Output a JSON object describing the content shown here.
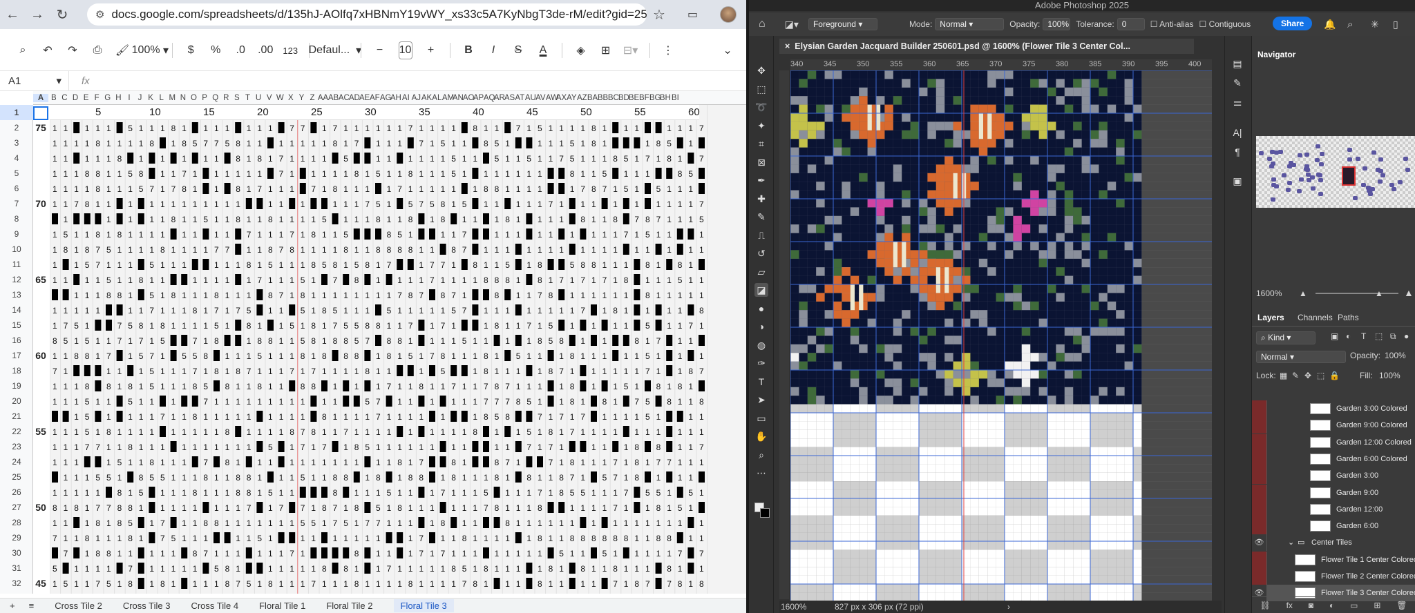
{
  "browser": {
    "url": "docs.google.com/spreadsheets/d/135hJ-AOlfq7xHBNmY19vWY_xs33c5A7KyNbgT3de-rM/edit?gid=25..."
  },
  "sheets": {
    "zoom": "100%",
    "currency": "$",
    "percent": "%",
    "dec_decrease": ".0",
    "dec_increase": ".00",
    "number_format": "123",
    "font": "Defaul...",
    "font_size": "10",
    "bold": "B",
    "italic": "I",
    "strike": "S",
    "textcolor": "A",
    "cell_ref": "A1",
    "fx": "fx",
    "columns": [
      "A",
      "B",
      "C",
      "D",
      "E",
      "F",
      "G",
      "H",
      "I",
      "J",
      "K",
      "L",
      "M",
      "N",
      "O",
      "P",
      "Q",
      "R",
      "S",
      "T",
      "U",
      "V",
      "W",
      "X",
      "Y",
      "Z",
      "AA",
      "AB",
      "AC",
      "AD",
      "AE",
      "AF",
      "AG",
      "AH",
      "AI",
      "AJ",
      "AK",
      "AL",
      "AM",
      "AN",
      "AO",
      "AP",
      "AQ",
      "AR",
      "AS",
      "AT",
      "AU",
      "AV",
      "AW",
      "AX",
      "AY",
      "AZ",
      "BA",
      "BB",
      "BC",
      "BD",
      "BE",
      "BF",
      "BG",
      "BH",
      "BI"
    ],
    "row1_labels": [
      "5",
      "10",
      "15",
      "20",
      "25",
      "30",
      "35",
      "40",
      "45",
      "50",
      "55",
      "60"
    ],
    "row_labels": [
      {
        "row": "2",
        "label": "75"
      },
      {
        "row": "7",
        "label": "70"
      },
      {
        "row": "12",
        "label": "65"
      },
      {
        "row": "17",
        "label": "60"
      },
      {
        "row": "22",
        "label": "55"
      },
      {
        "row": "27",
        "label": "50"
      },
      {
        "row": "32",
        "label": "45"
      }
    ],
    "row_numbers": [
      "1",
      "2",
      "3",
      "4",
      "5",
      "6",
      "7",
      "8",
      "9",
      "10",
      "11",
      "12",
      "13",
      "14",
      "15",
      "16",
      "17",
      "18",
      "19",
      "20",
      "21",
      "22",
      "23",
      "24",
      "25",
      "26",
      "27",
      "28",
      "29",
      "30",
      "31",
      "32"
    ],
    "tabs": [
      "Cross Tile 2",
      "Cross Tile 3",
      "Cross Tile 4",
      "Floral Tile 1",
      "Floral Tile 2",
      "Floral Tile 3"
    ],
    "active_tab": "Floral Tile 3"
  },
  "photoshop": {
    "app_title": "Adobe Photoshop 2025",
    "options": {
      "fill_source": "Foreground",
      "mode_label": "Mode:",
      "mode": "Normal",
      "opacity_label": "Opacity:",
      "opacity": "100%",
      "tolerance_label": "Tolerance:",
      "tolerance": "0",
      "antialias": "Anti-alias",
      "contiguous": "Contiguous",
      "share": "Share"
    },
    "document_tab": "Elysian Garden Jacquard Builder 250601.psd @ 1600% (Flower Tile 3 Center Col...",
    "ruler": [
      "340",
      "345",
      "350",
      "355",
      "360",
      "365",
      "370",
      "375",
      "380",
      "385",
      "390",
      "395",
      "400"
    ],
    "status_zoom": "1600%",
    "status_info": "827 px x 306 px (72 ppi)",
    "navigator": {
      "title": "Navigator",
      "zoom": "1600%"
    },
    "layers_panel": {
      "tabs": [
        "Layers",
        "Channels",
        "Paths"
      ],
      "filter": "Kind",
      "blend": "Normal",
      "opacity_label": "Opacity:",
      "opacity": "100%",
      "lock_label": "Lock:",
      "fill_label": "Fill:",
      "fill": "100%",
      "layers": [
        {
          "name": "Garden 3:00 Colored",
          "visible": false,
          "indent": 1,
          "thumb": true
        },
        {
          "name": "Garden 9:00 Colored",
          "visible": false,
          "indent": 1,
          "thumb": true
        },
        {
          "name": "Garden 12:00 Colored",
          "visible": false,
          "indent": 1,
          "thumb": true
        },
        {
          "name": "Garden 6:00 Colored",
          "visible": false,
          "indent": 1,
          "thumb": true
        },
        {
          "name": "Garden 3:00",
          "visible": false,
          "indent": 1,
          "thumb": true
        },
        {
          "name": "Garden 9:00",
          "visible": false,
          "indent": 1,
          "thumb": true
        },
        {
          "name": "Garden 12:00",
          "visible": false,
          "indent": 1,
          "thumb": true
        },
        {
          "name": "Garden 6:00",
          "visible": false,
          "indent": 1,
          "thumb": true
        },
        {
          "name": "Center Tiles",
          "visible": true,
          "indent": 0,
          "group": true
        },
        {
          "name": "Flower Tile 1 Center Colored",
          "visible": false,
          "indent": 0,
          "thumb": true
        },
        {
          "name": "Flower Tile 2 Center Colored",
          "visible": false,
          "indent": 0,
          "thumb": true
        },
        {
          "name": "Flower Tile 3 Center Colored",
          "visible": true,
          "indent": 0,
          "thumb": true,
          "selected": true
        }
      ]
    },
    "colors": {
      "navy": "#0b1433",
      "orange": "#d8692e",
      "gray": "#8a8f9b",
      "green": "#3f6a3a",
      "cream": "#ece7cf",
      "pink": "#d043a2",
      "yellow": "#c4c24a",
      "white": "#f2f2f2"
    }
  }
}
